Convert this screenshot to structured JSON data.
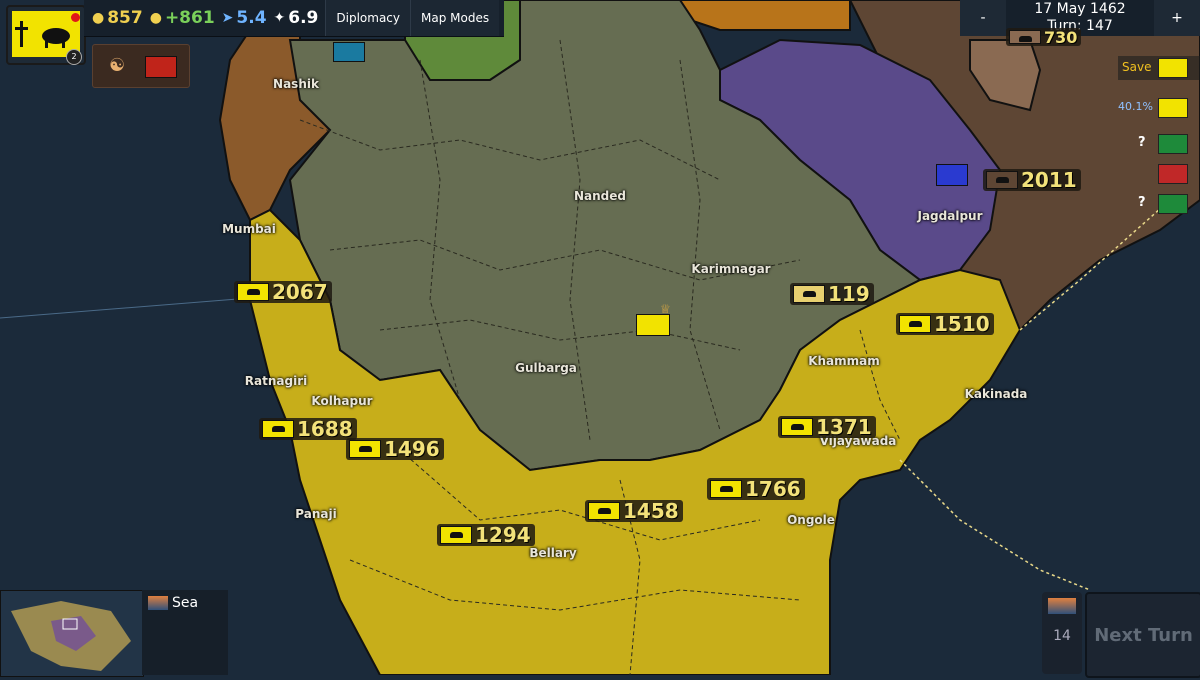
{
  "resources": {
    "gold": "857",
    "income": "+861",
    "movement": "5.4",
    "diplomacy": "6.9"
  },
  "menu": {
    "diplomacy": "Diplomacy",
    "map_modes": "Map Modes"
  },
  "header": {
    "date": "17 May 1462",
    "turn": "Turn: 147",
    "minus": "-",
    "plus": "+"
  },
  "player": {
    "level": "2"
  },
  "side": {
    "save": "Save",
    "percent": "40.1%",
    "unknown1": "?",
    "unknown2": "?"
  },
  "cities": [
    {
      "name": "Nashik"
    },
    {
      "name": "Mumbai"
    },
    {
      "name": "Nanded"
    },
    {
      "name": "Karimnagar"
    },
    {
      "name": "Jagdalpur"
    },
    {
      "name": "Khammam"
    },
    {
      "name": "Gulbarga"
    },
    {
      "name": "Ratnagiri"
    },
    {
      "name": "Kolhapur"
    },
    {
      "name": "Kakinada"
    },
    {
      "name": "Vijayawada"
    },
    {
      "name": "Panaji"
    },
    {
      "name": "Ongole"
    },
    {
      "name": "Bellary"
    }
  ],
  "armies": [
    {
      "size": "2067"
    },
    {
      "size": "119"
    },
    {
      "size": "1510"
    },
    {
      "size": "2011"
    },
    {
      "size": "1688"
    },
    {
      "size": "1496"
    },
    {
      "size": "1371"
    },
    {
      "size": "1766"
    },
    {
      "size": "1458"
    },
    {
      "size": "1294"
    },
    {
      "size": "730"
    }
  ],
  "bottom": {
    "sea_label": "Sea",
    "next_turn": "Next Turn",
    "turn_count": "14"
  },
  "colors": {
    "sea": "#1b2a3a",
    "player_yellow": "#c7ae1a",
    "deccan_green": "#666d52",
    "purple": "#5a4a8a",
    "brown_east": "#5e4634",
    "brown_west": "#8b5a2b"
  },
  "icons": [
    "gold-icon",
    "income-icon",
    "movement-icon",
    "diplomacy-dove-icon",
    "fortress-icon",
    "crown-icon",
    "handshake-icon"
  ]
}
